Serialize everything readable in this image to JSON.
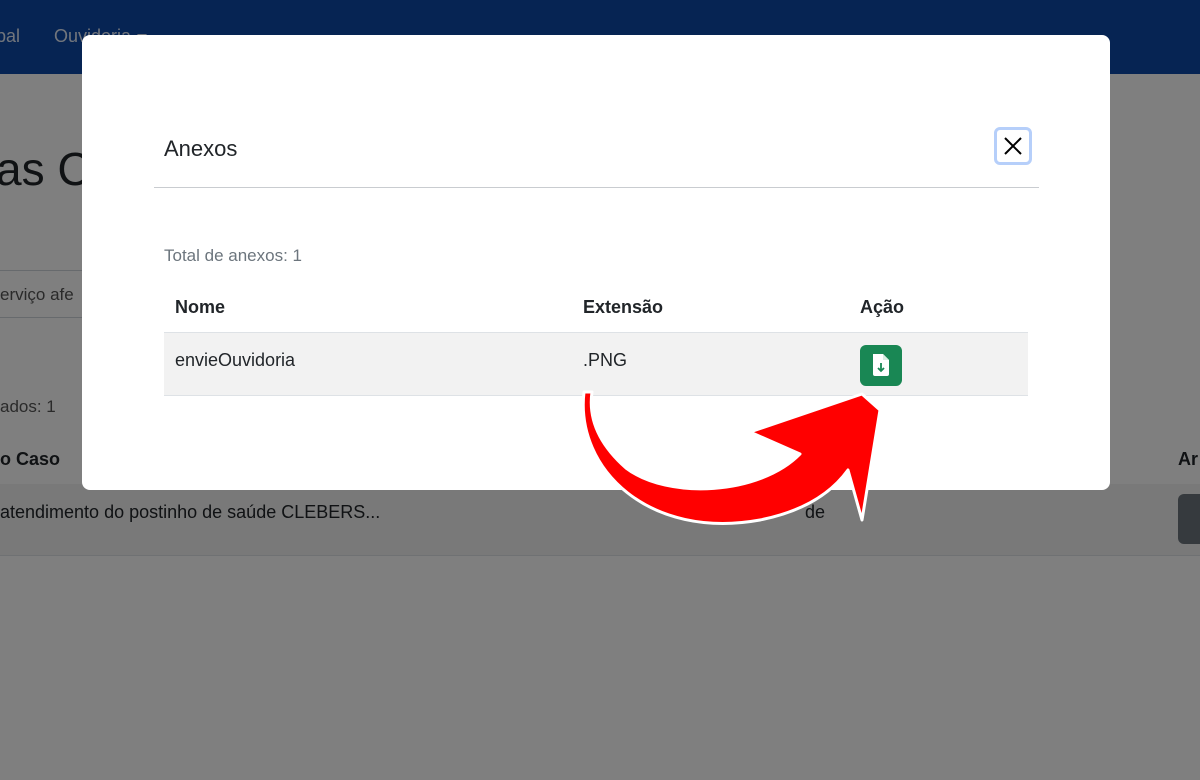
{
  "navbar": {
    "items": [
      "ipal",
      "Ouvidoria"
    ]
  },
  "background": {
    "title": "as C",
    "search_text": "erviço afe",
    "count_text": "ados: 1",
    "columns": [
      "o Caso",
      "Ar"
    ],
    "row": {
      "description": "atendimento do postinho de saúde CLEBERS...",
      "status": "de"
    }
  },
  "modal": {
    "title": "Anexos",
    "total_label": "Total de anexos: 1",
    "columns": [
      "Nome",
      "Extensão",
      "Ação"
    ],
    "rows": [
      {
        "name": "envieOuvidoria",
        "extension": ".PNG",
        "action_icon": "file-download-icon"
      }
    ]
  },
  "colors": {
    "navbar": "#0d48a6",
    "download_button": "#198754",
    "annotation_arrow": "#ff0000"
  }
}
